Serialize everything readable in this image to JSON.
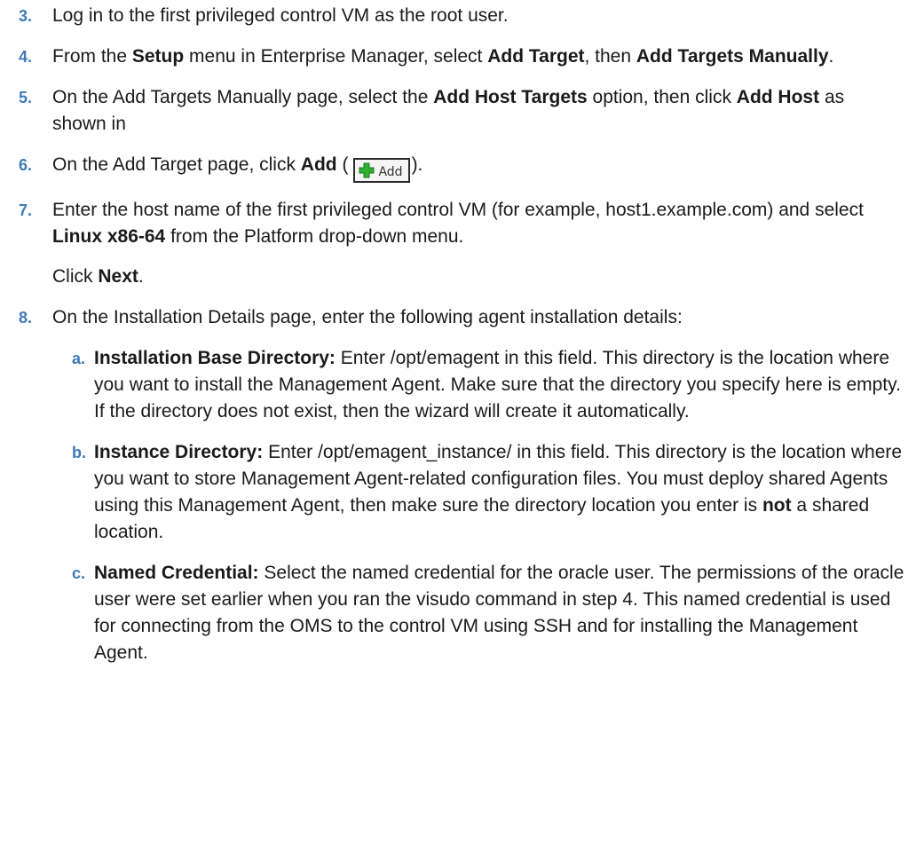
{
  "steps": [
    {
      "num": "3.",
      "parts": [
        "Log in to the first privileged control VM as the root user."
      ]
    },
    {
      "num": "4.",
      "parts": [
        "From the ",
        "Setup",
        " menu in Enterprise Manager, select ",
        "Add Target",
        ", then ",
        "Add Targets Manually",
        "."
      ]
    },
    {
      "num": "5.",
      "parts": [
        "On the Add Targets Manually page, select the ",
        "Add Host Targets",
        " option, then click ",
        "Add Host",
        " as shown in"
      ]
    },
    {
      "num": "6.",
      "parts": [
        "On the Add Target page, click ",
        "Add",
        " (",
        ")."
      ],
      "button_label": "Add",
      "button_icon": "green-plus-icon"
    },
    {
      "num": "7.",
      "parts": [
        "Enter the host name of the first privileged control VM (for example, host1.example.com) and select ",
        "Linux x86-64",
        " from the Platform drop-down menu."
      ],
      "after": [
        "Click ",
        "Next",
        "."
      ]
    },
    {
      "num": "8.",
      "parts": [
        "On the Installation Details page, enter the following agent installation details:"
      ]
    }
  ],
  "substeps": [
    {
      "letter": "a.",
      "parts": [
        "Installation Base Directory:",
        " Enter /opt/emagent in this field. This directory is the location where you want to install the Management Agent. Make sure that the directory you specify here is empty. If the directory does not exist, then the wizard will create it automatically."
      ]
    },
    {
      "letter": "b.",
      "parts": [
        "Instance Directory:",
        " Enter /opt/emagent_instance/ in this field. This directory is the location where you want to store Management Agent-related configuration files. You must deploy shared Agents using this Management Agent, then make sure the directory location you enter is ",
        "not",
        " a shared location."
      ]
    },
    {
      "letter": "c.",
      "parts": [
        "Named Credential:",
        " Select the named credential for the oracle user. The permissions of the oracle user were set earlier when you ran the visudo command in step 4. This named credential is used for connecting from the OMS to the control VM using SSH and for installing the Management Agent."
      ]
    }
  ],
  "colors": {
    "number": "#3d7ab8",
    "text": "#1a1a1a",
    "icon_green": "#2fae2f"
  }
}
